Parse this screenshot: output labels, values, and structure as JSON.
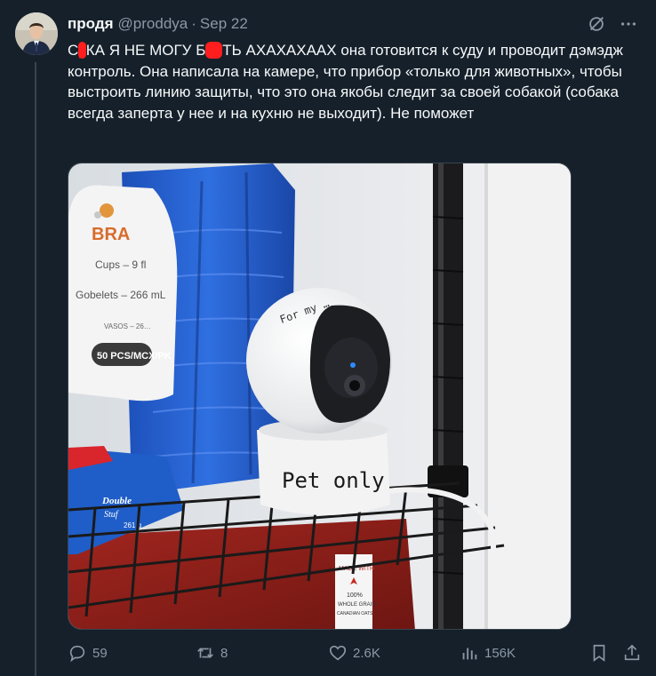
{
  "author": {
    "name": "продя",
    "handle": "@proddya",
    "separator": "·",
    "date": "Sep 22"
  },
  "tweet": {
    "part1": "С",
    "redact1": "у",
    "part2": "КА Я НЕ МОГУ Б",
    "redact2": "ля",
    "part3": "ТЬ АХАХАХААХ она готовится к суду и проводит дэмэдж контроль. Она написала на камере, что прибор «только для животных», чтобы выстроить линию защиты, что это она якобы следит за своей собакой (собака всегда заперта у нее и на кухню не выходит). Не поможет"
  },
  "photo": {
    "cup_brand": "BRA",
    "cups_line": "Cups – 9 fl",
    "gobelets_line": "Gobelets – 266 mL",
    "vasos_line": "VASOS – 26…",
    "pcs_badge": "50 PCS/MCX/PK",
    "camera_top_note": "For my …",
    "camera_label": "Pet only",
    "bag_label1": "Double",
    "bag_label2": "Stuf",
    "bag_label3": "261 g",
    "box_line1": "MADE WITH",
    "box_line2": "100%",
    "box_line3": "WHOLE GRAIN",
    "box_line4": "CANADIAN OATS"
  },
  "actions": {
    "replies": "59",
    "reposts": "8",
    "likes": "2.6K",
    "views": "156K"
  },
  "colors": {
    "background": "#15202b",
    "text": "#f7f9f9",
    "muted": "#8b98a5",
    "redaction": "#ff1e1e"
  },
  "icons": [
    "grok-icon",
    "more-icon",
    "reply-icon",
    "repost-icon",
    "like-icon",
    "views-icon",
    "bookmark-icon",
    "share-icon"
  ]
}
